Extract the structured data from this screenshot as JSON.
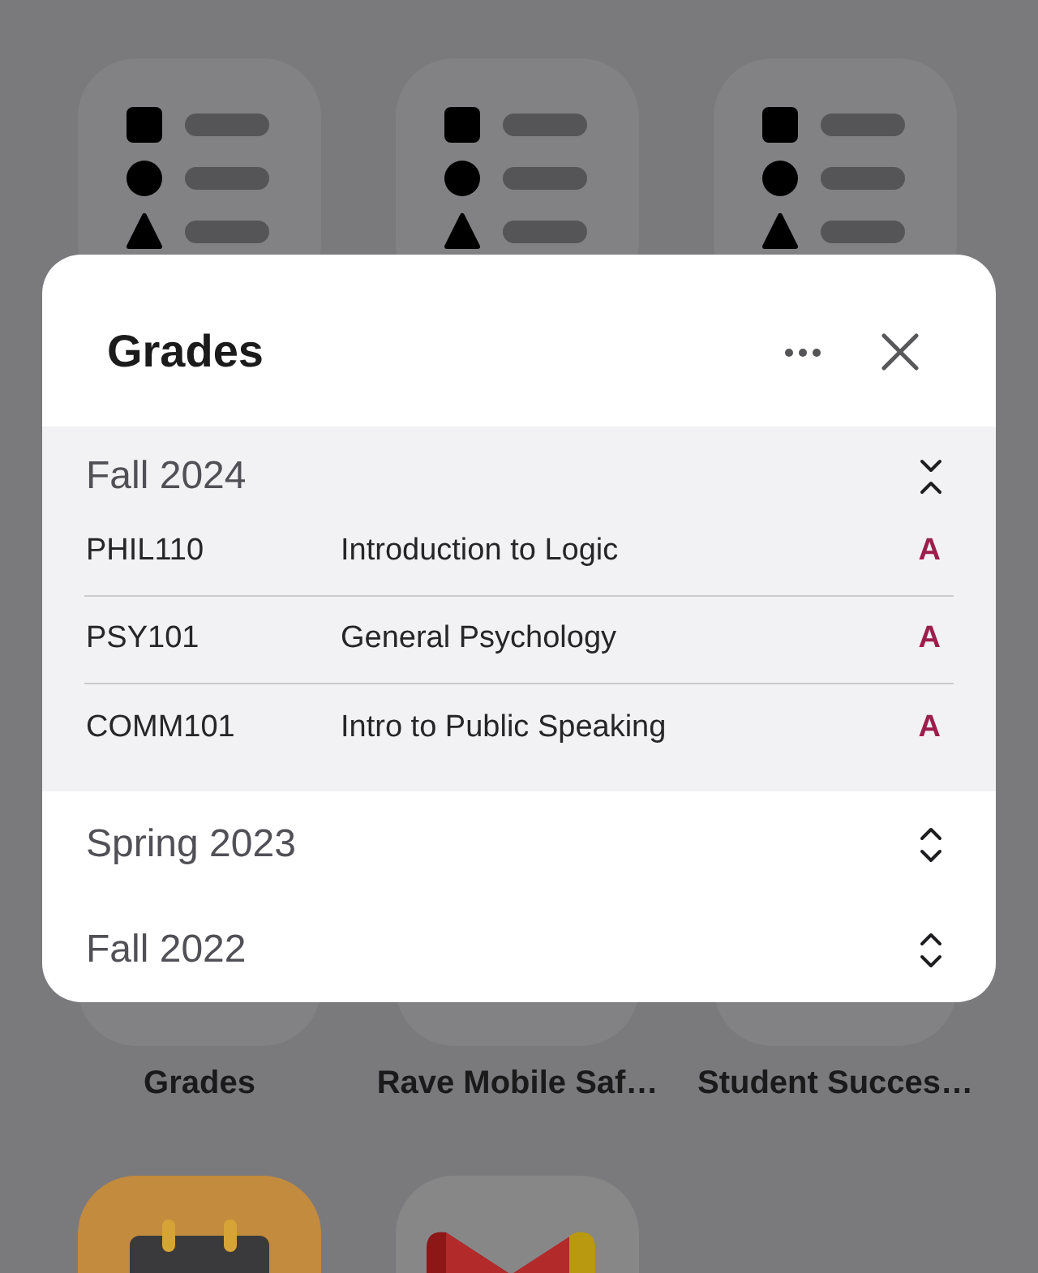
{
  "home_screen": {
    "rows": [
      {
        "apps": [
          {
            "kind": "list"
          },
          {
            "kind": "list"
          },
          {
            "kind": "list"
          }
        ]
      },
      {
        "apps": [
          {
            "label": "Grades"
          },
          {
            "label": "Rave Mobile Saf…"
          },
          {
            "label": "Student Succes…"
          }
        ]
      },
      {
        "apps": [
          {
            "kind": "calendar"
          },
          {
            "kind": "mail"
          }
        ]
      }
    ]
  },
  "dialog": {
    "title": "Grades",
    "terms": [
      {
        "name": "Fall 2024",
        "expanded": true,
        "courses": [
          {
            "code": "PHIL110",
            "title": "Introduction to Logic",
            "grade": "A"
          },
          {
            "code": "PSY101",
            "title": "General Psychology",
            "grade": "A"
          },
          {
            "code": "COMM101",
            "title": "Intro to Public Speaking",
            "grade": "A"
          }
        ]
      },
      {
        "name": "Spring 2023",
        "expanded": false
      },
      {
        "name": "Fall 2022",
        "expanded": false
      }
    ]
  }
}
